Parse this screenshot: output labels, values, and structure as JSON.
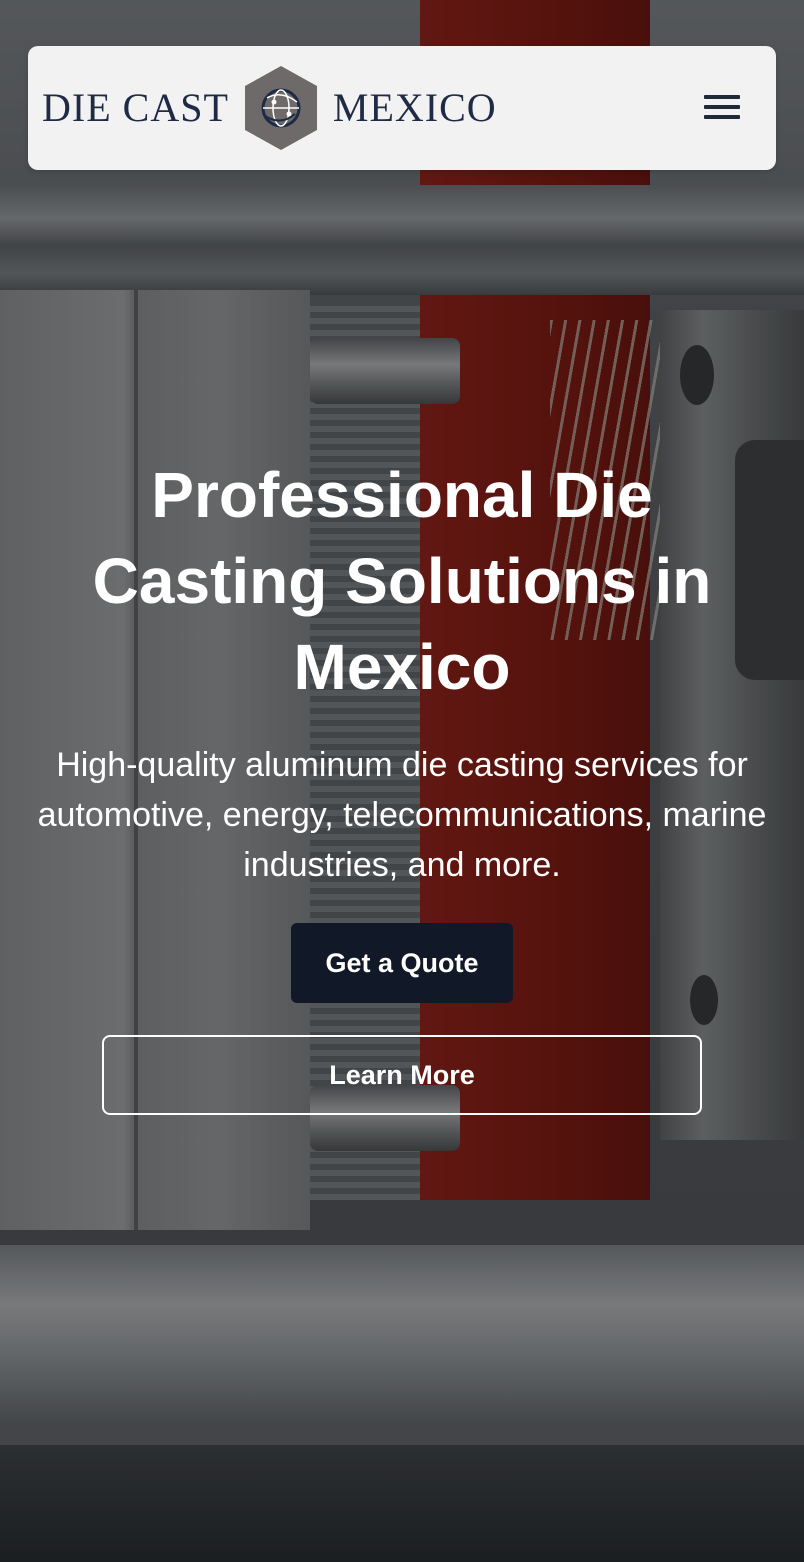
{
  "header": {
    "logo": {
      "left_text": "DIE CAST",
      "right_text": "MEXICO"
    },
    "menu_icon": "hamburger-menu-icon"
  },
  "hero": {
    "title": "Professional Die Casting Solutions in Mexico",
    "subtitle": "High-quality aluminum die casting services for automotive, energy, telecommunications, marine industries, and more.",
    "primary_button": "Get a Quote",
    "secondary_button": "Learn More"
  },
  "colors": {
    "header_bg": "#f2f2f2",
    "logo_text": "#1f2a44",
    "logo_hex": "#6e6a69",
    "primary_button_bg": "#111827",
    "text_on_hero": "#ffffff"
  }
}
